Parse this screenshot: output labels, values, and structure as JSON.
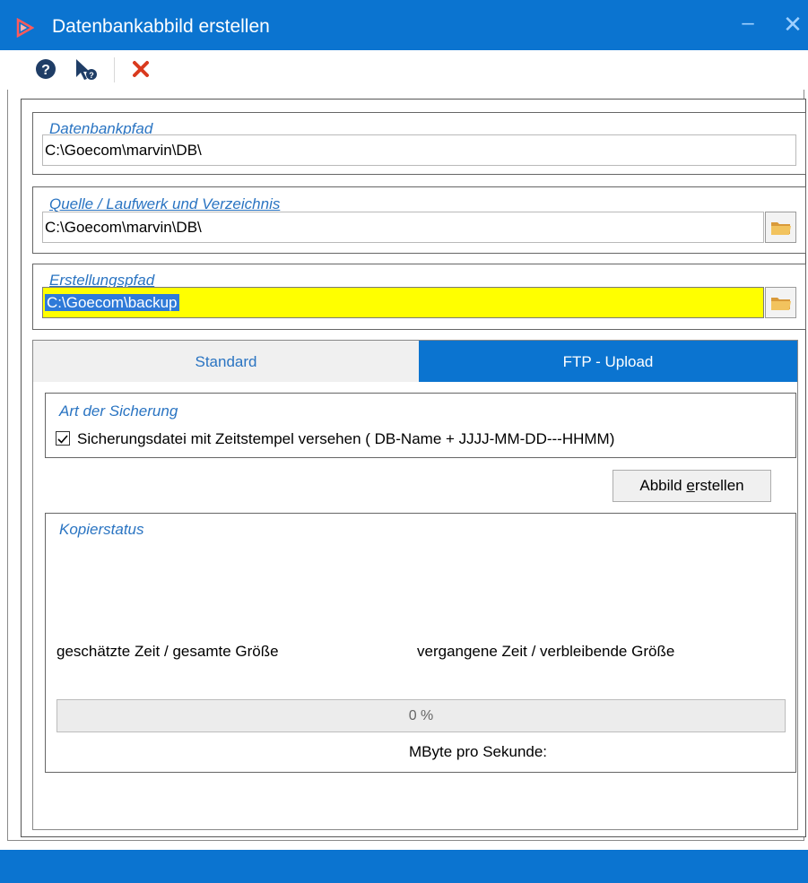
{
  "window": {
    "title": "Datenbankabbild erstellen",
    "minimize": "–",
    "close": "✕"
  },
  "toolbar": {
    "help_icon": "help-circle-icon",
    "context_help_icon": "context-help-icon",
    "close_icon": "red-x-icon"
  },
  "db_path": {
    "label": "Datenbankpfad",
    "value": "C:\\Goecom\\marvin\\DB\\"
  },
  "source": {
    "label": "Quelle / Laufwerk und Verzeichnis",
    "value": "C:\\Goecom\\marvin\\DB\\"
  },
  "target": {
    "label": "Erstellungspfad",
    "value": "C:\\Goecom\\backup"
  },
  "tabs": [
    {
      "label": "Standard",
      "active": false
    },
    {
      "label": "FTP - Upload",
      "active": true
    }
  ],
  "backup_type": {
    "label": "Art der Sicherung",
    "checkbox_label": "Sicherungsdatei mit Zeitstempel versehen ( DB-Name + JJJJ-MM-DD---HHMM)",
    "checked": true
  },
  "create_button": {
    "prefix": "Abbild ",
    "mnemonic": "e",
    "suffix": "rstellen"
  },
  "copy_status": {
    "label": "Kopierstatus",
    "estimated": "geschätzte Zeit / gesamte Größe",
    "elapsed": "vergangene Zeit / verbleibende Größe",
    "progress_text": "0 %",
    "progress_value": 0,
    "speed_label": "MByte pro Sekunde:"
  },
  "colors": {
    "accent": "#0b74d0",
    "label_blue": "#2a74c2",
    "highlight_field": "#ffff00",
    "close_red": "#d93a1e"
  }
}
